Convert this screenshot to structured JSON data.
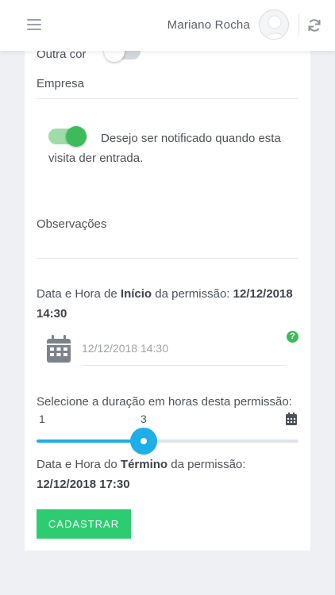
{
  "header": {
    "user_name": "Mariano Rocha"
  },
  "form": {
    "outra_cor_label": "Outra cor",
    "outra_cor_on": false,
    "empresa_label": "Empresa",
    "notify_on": true,
    "notify_text": "Desejo ser notificado quando esta visita der entrada.",
    "observacoes_label": "Observações",
    "start": {
      "prefix": "Data e Hora de ",
      "bold_word": "Início",
      "middle": " da permissão: ",
      "datetime": "12/12/2018 14:30"
    },
    "date_input_value": "12/12/2018 14:30",
    "duration_label": "Selecione a duração em horas desta permissão:",
    "slider": {
      "min_label": "1",
      "value_label": "3",
      "fraction": 0.41
    },
    "end": {
      "prefix": "Data e Hora do ",
      "bold_word": "Término",
      "middle": " da permissão:",
      "datetime": "12/12/2018 17:30"
    },
    "submit_label": "CADASTRAR"
  },
  "colors": {
    "accent_green": "#2ecc71",
    "slider_blue": "#1eaee8"
  },
  "icons": {
    "menu": "hamburger-icon",
    "refresh": "refresh-icon",
    "calendar": "calendar-icon",
    "help": "question-icon"
  }
}
